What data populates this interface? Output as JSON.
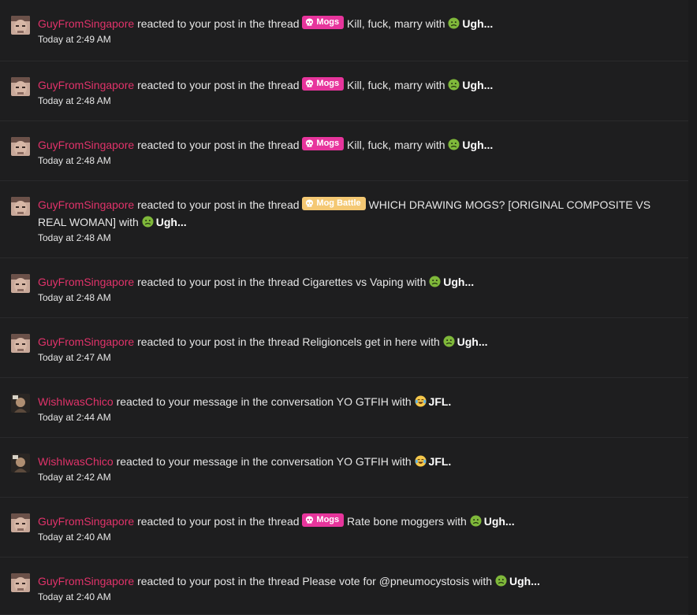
{
  "colors": {
    "background": "#1e1e1f",
    "username": "#e0336a",
    "prefix_mogs": "#e7359c",
    "prefix_mog_battle": "#f4c873"
  },
  "alerts": [
    {
      "user": "GuyFromSingapore",
      "action": "reacted to your post in the thread",
      "prefix": "Mogs",
      "title": "Kill, fuck, marry",
      "with": "with",
      "reaction_icon": "nauseated-face-icon",
      "reaction": "Ugh...",
      "time": "Today at 2:49 AM"
    },
    {
      "user": "GuyFromSingapore",
      "action": "reacted to your post in the thread",
      "prefix": "Mogs",
      "title": "Kill, fuck, marry",
      "with": "with",
      "reaction_icon": "nauseated-face-icon",
      "reaction": "Ugh...",
      "time": "Today at 2:48 AM"
    },
    {
      "user": "GuyFromSingapore",
      "action": "reacted to your post in the thread",
      "prefix": "Mogs",
      "title": "Kill, fuck, marry",
      "with": "with",
      "reaction_icon": "nauseated-face-icon",
      "reaction": "Ugh...",
      "time": "Today at 2:48 AM"
    },
    {
      "user": "GuyFromSingapore",
      "action": "reacted to your post in the thread",
      "prefix": "Mog Battle",
      "title": "WHICH DRAWING MOGS? [ORIGINAL COMPOSITE VS REAL WOMAN]",
      "with": "with",
      "reaction_icon": "nauseated-face-icon",
      "reaction": "Ugh...",
      "time": "Today at 2:48 AM"
    },
    {
      "user": "GuyFromSingapore",
      "action": "reacted to your post in the thread",
      "prefix": "",
      "title": "Cigarettes vs Vaping",
      "with": "with",
      "reaction_icon": "nauseated-face-icon",
      "reaction": "Ugh...",
      "time": "Today at 2:48 AM"
    },
    {
      "user": "GuyFromSingapore",
      "action": "reacted to your post in the thread",
      "prefix": "",
      "title": "Religioncels get in here",
      "with": "with",
      "reaction_icon": "nauseated-face-icon",
      "reaction": "Ugh...",
      "time": "Today at 2:47 AM"
    },
    {
      "user": "WishIwasChico",
      "action": "reacted to your message in the conversation",
      "prefix": "",
      "title": "YO GTFIH",
      "with": "with",
      "reaction_icon": "joy-tears-icon",
      "reaction": "JFL.",
      "time": "Today at 2:44 AM"
    },
    {
      "user": "WishIwasChico",
      "action": "reacted to your message in the conversation",
      "prefix": "",
      "title": "YO GTFIH",
      "with": "with",
      "reaction_icon": "joy-tears-icon",
      "reaction": "JFL.",
      "time": "Today at 2:42 AM"
    },
    {
      "user": "GuyFromSingapore",
      "action": "reacted to your post in the thread",
      "prefix": "Mogs",
      "title": "Rate bone moggers",
      "with": "with",
      "reaction_icon": "nauseated-face-icon",
      "reaction": "Ugh...",
      "time": "Today at 2:40 AM"
    },
    {
      "user": "GuyFromSingapore",
      "action": "reacted to your post in the thread",
      "prefix": "",
      "title": "Please vote for @pneumocystosis",
      "with": "with",
      "reaction_icon": "nauseated-face-icon",
      "reaction": "Ugh...",
      "time": "Today at 2:40 AM"
    }
  ]
}
